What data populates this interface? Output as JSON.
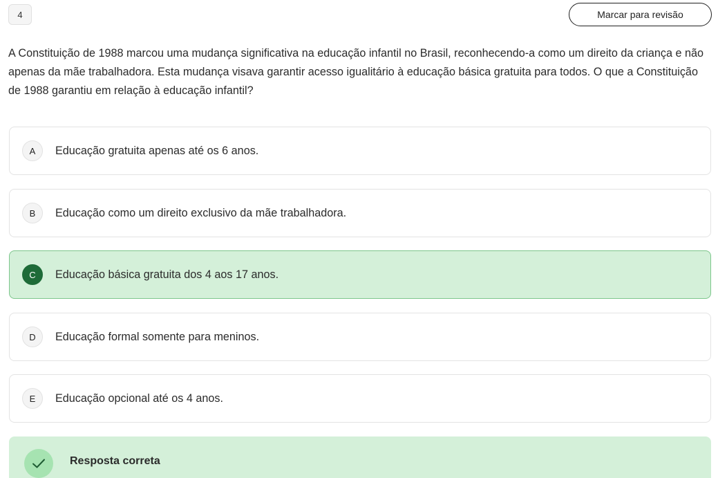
{
  "question": {
    "number": "4",
    "review_label": "Marcar para revisão",
    "statement": "A Constituição de 1988 marcou uma mudança significativa na educação infantil no Brasil, reconhecendo-a como um direito da criança e não apenas da mãe trabalhadora. Esta mudança visava garantir acesso igualitário à educação básica gratuita para todos. O que a Constituição de 1988 garantiu em relação à educação infantil?"
  },
  "options": [
    {
      "letter": "A",
      "text": "Educação gratuita apenas até os 6 anos."
    },
    {
      "letter": "B",
      "text": "Educação como um direito exclusivo da mãe trabalhadora."
    },
    {
      "letter": "C",
      "text": "Educação básica gratuita dos 4 aos 17 anos."
    },
    {
      "letter": "D",
      "text": "Educação formal somente para meninos."
    },
    {
      "letter": "E",
      "text": "Educação opcional até os 4 anos."
    }
  ],
  "selected_option": "C",
  "feedback": {
    "title": "Resposta correta",
    "icon": "check-icon"
  },
  "colors": {
    "correct_background": "#d4f0d9",
    "correct_border": "#7cc68b",
    "correct_badge": "#1e6b38",
    "check_circle": "#a6e3b1"
  }
}
